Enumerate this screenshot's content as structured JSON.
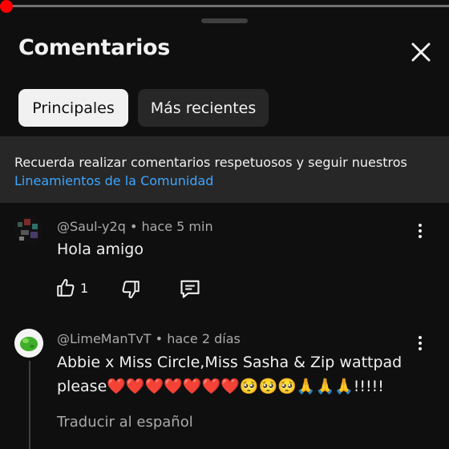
{
  "header": {
    "title": "Comentarios",
    "close_icon": "close-icon"
  },
  "filters": {
    "top_label": "Principales",
    "newest_label": "Más recientes"
  },
  "notice": {
    "text": "Recuerda realizar comentarios respetuosos y seguir nuestros",
    "link": "Lineamientos de la Comunidad"
  },
  "comments": [
    {
      "author": "@Saul-y2q",
      "time": "hace 5 min",
      "text": "Hola amigo",
      "likes": "1"
    },
    {
      "author": "@LimeManTvT",
      "time": "hace 2 días",
      "text_line1": "Abbie x Miss Circle,Miss Sasha & Zip wattpad",
      "text_line2": "please❤️❤️❤️❤️❤️❤️❤️🥺🥺🥺🙏🙏🙏!!!!!",
      "translate": "Traducir al español"
    }
  ],
  "colors": {
    "background": "#0f0f0f",
    "link": "#3ea6ff",
    "progress": "#ff0000"
  }
}
